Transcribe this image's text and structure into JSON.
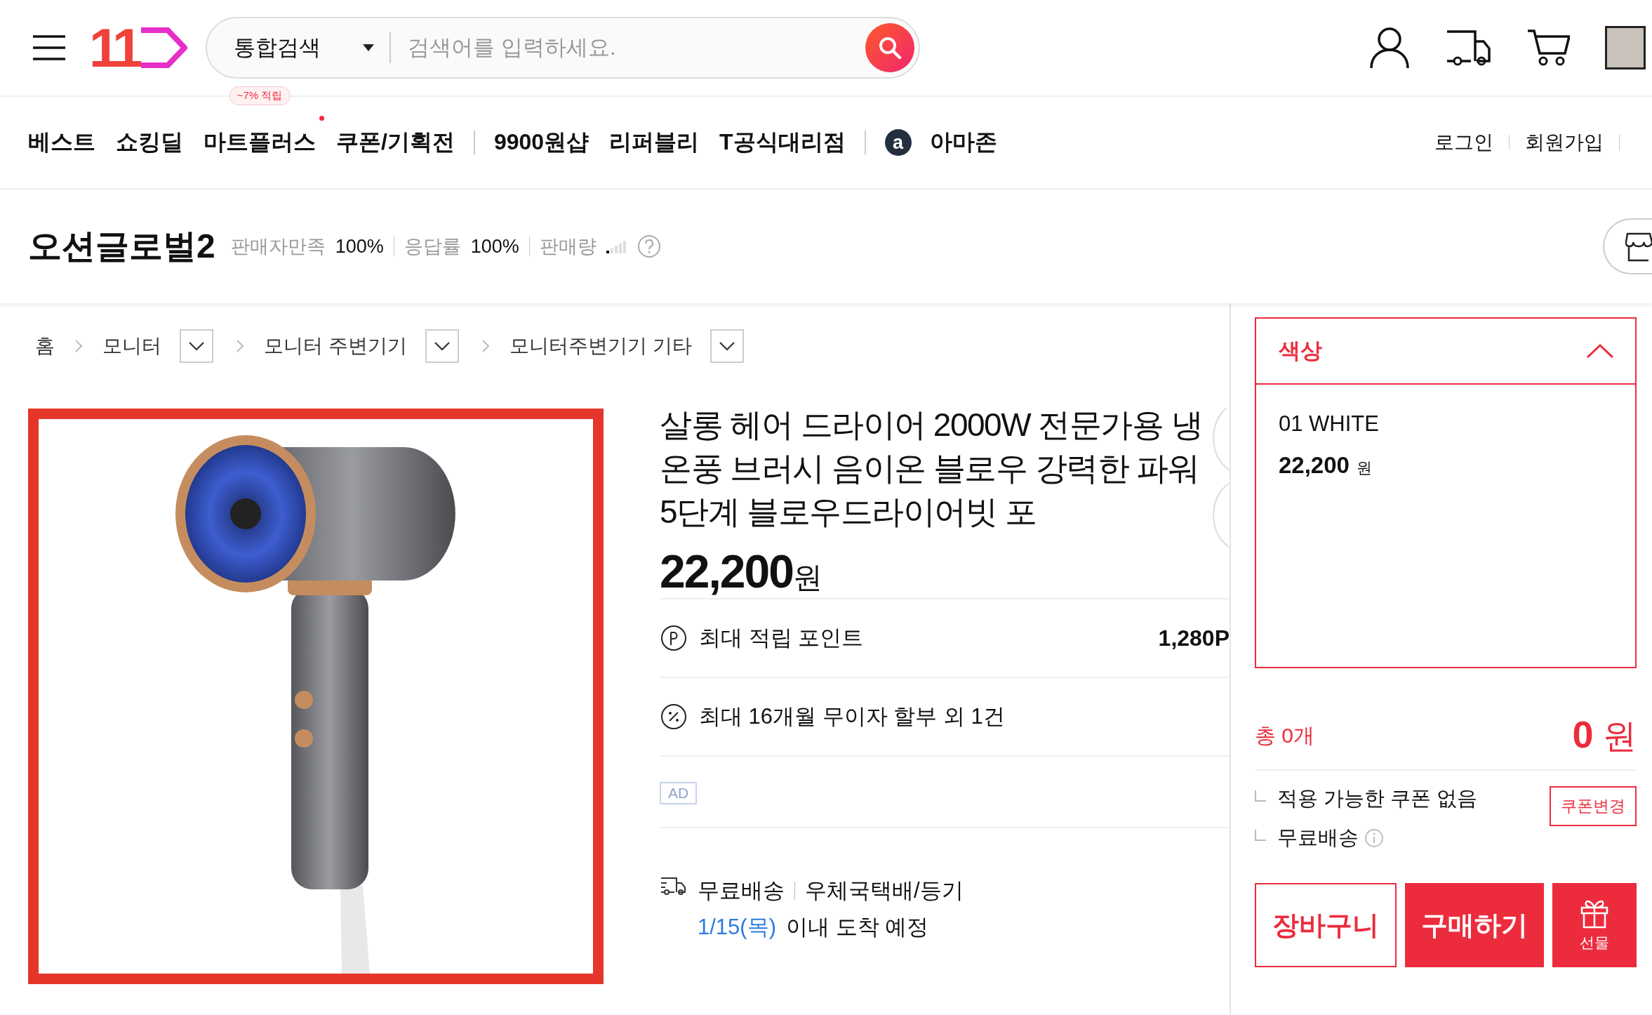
{
  "header": {
    "logo": "11",
    "search": {
      "scope": "통합검색",
      "placeholder": "검색어를 입력하세요."
    }
  },
  "nav": {
    "groups": [
      [
        {
          "label": "베스트",
          "dot": false
        },
        {
          "label": "쇼킹딜",
          "dot": false
        },
        {
          "label": "마트플러스",
          "badge": "~7% 적립",
          "dot": true
        },
        {
          "label": "쿠폰/기획전",
          "dot": false
        }
      ],
      [
        {
          "label": "9900원샵",
          "dot": false
        },
        {
          "label": "리퍼블리",
          "dot": false
        },
        {
          "label": "T공식대리점",
          "dot": false
        }
      ],
      [
        {
          "label": "아마존",
          "icon_letter": "a",
          "dot": false
        }
      ]
    ],
    "account_links": [
      "로그인",
      "회원가입"
    ]
  },
  "seller": {
    "name": "오션글로벌2",
    "stats": [
      {
        "kind": "text",
        "label": "판매자만족",
        "value": "100%"
      },
      {
        "kind": "text",
        "label": "응답률",
        "value": "100%"
      },
      {
        "kind": "meter",
        "label": "판매량",
        "level": 0.2
      }
    ]
  },
  "breadcrumb": [
    {
      "label": "홈",
      "has_menu": false
    },
    {
      "label": "모니터",
      "has_menu": true
    },
    {
      "label": "모니터 주변기기",
      "has_menu": true
    },
    {
      "label": "모니터주변기기 기타",
      "has_menu": true
    }
  ],
  "product": {
    "title": "살롱 헤어 드라이어 2000W 전문가용 냉온풍 브러시 음이온 블로우 강력한 파워 5단계 블로우드라이어빗 포",
    "price": "22,200",
    "currency": "원",
    "benefits": [
      {
        "kind": "points",
        "label": "최대 적립 포인트",
        "value": "1,280P"
      },
      {
        "kind": "installment",
        "label": "최대 16개월 무이자 할부 외 1건"
      }
    ],
    "ad_label": "AD",
    "delivery": {
      "fee": "무료배송",
      "method": "우체국택배/등기",
      "date": "1/15(목)",
      "arrival": "이내 도착 예정"
    }
  },
  "options": {
    "label": "색상",
    "expanded": true,
    "items": [
      {
        "name": "01 WHITE",
        "price": "22,200",
        "currency": "원"
      }
    ]
  },
  "summary": {
    "count": "총 0개",
    "total": "0",
    "currency": "원",
    "coupon": "적용 가능한 쿠폰 없음",
    "coupon_button": "쿠폰변경",
    "shipping": "무료배송"
  },
  "actions": [
    {
      "kind": "cart",
      "label": "장바구니"
    },
    {
      "kind": "buy",
      "label": "구매하기"
    },
    {
      "kind": "gift",
      "label": "선물"
    }
  ]
}
